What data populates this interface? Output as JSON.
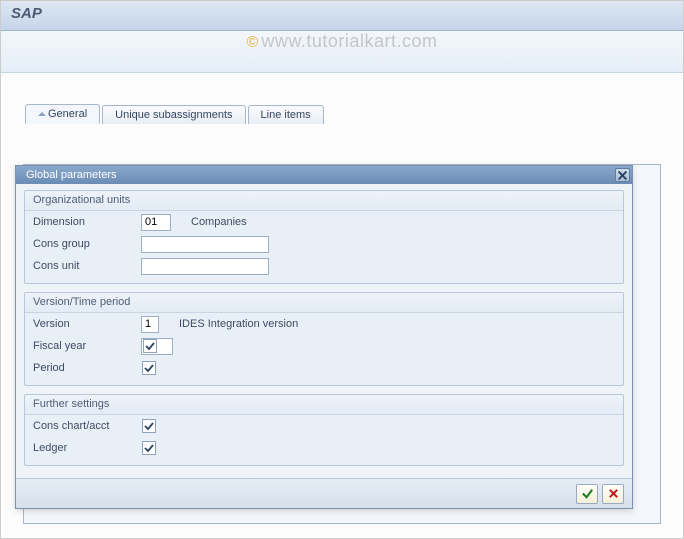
{
  "app": {
    "title": "SAP"
  },
  "watermark": {
    "copyright": "©",
    "text": "www.tutorialkart.com"
  },
  "tabs": {
    "items": [
      {
        "label": "General"
      },
      {
        "label": "Unique subassignments"
      },
      {
        "label": "Line items"
      }
    ]
  },
  "modal": {
    "title": "Global parameters",
    "groups": {
      "org": {
        "title": "Organizational units",
        "dimension": {
          "label": "Dimension",
          "value": "01",
          "desc": "Companies"
        },
        "cons_group": {
          "label": "Cons group",
          "value": ""
        },
        "cons_unit": {
          "label": "Cons unit",
          "value": ""
        }
      },
      "vtp": {
        "title": "Version/Time period",
        "version": {
          "label": "Version",
          "value": "1",
          "desc": "IDES Integration version"
        },
        "fiscal_year": {
          "label": "Fiscal year",
          "checked": true
        },
        "period": {
          "label": "Period",
          "checked": true
        }
      },
      "fs": {
        "title": "Further settings",
        "cons_chart": {
          "label": "Cons chart/acct",
          "checked": true
        },
        "ledger": {
          "label": "Ledger",
          "checked": true
        }
      }
    }
  }
}
